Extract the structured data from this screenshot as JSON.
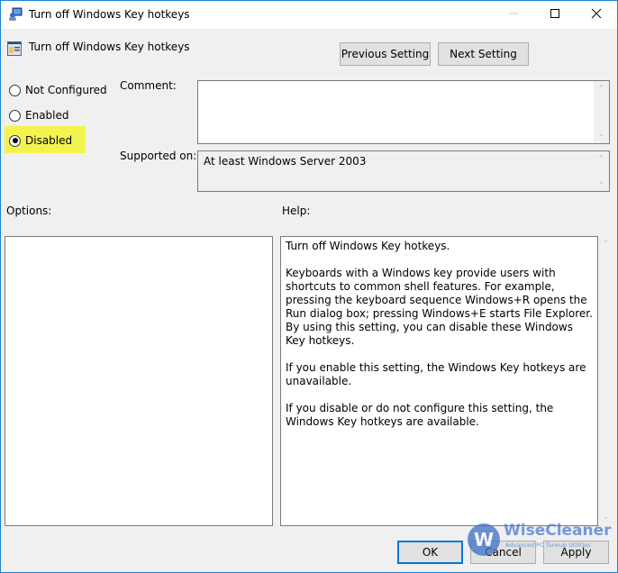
{
  "window": {
    "title": "Turn off Windows Key hotkeys",
    "controls": {
      "minimize": "minimize",
      "maximize": "maximize",
      "close": "close"
    }
  },
  "header": {
    "setting_name": "Turn off Windows Key hotkeys",
    "previous_label": "Previous Setting",
    "next_label": "Next Setting"
  },
  "state": {
    "options": [
      {
        "label": "Not Configured",
        "checked": false
      },
      {
        "label": "Enabled",
        "checked": false
      },
      {
        "label": "Disabled",
        "checked": true
      }
    ],
    "highlight_color": "#f3f350"
  },
  "comment": {
    "label": "Comment:",
    "value": ""
  },
  "supported": {
    "label": "Supported on:",
    "value": "At least Windows Server 2003"
  },
  "options_panel": {
    "label": "Options:"
  },
  "help_panel": {
    "label": "Help:",
    "text": "Turn off Windows Key hotkeys.\n\nKeyboards with a Windows key provide users with shortcuts to common shell features. For example, pressing the keyboard sequence Windows+R opens the Run dialog box; pressing Windows+E starts File Explorer. By using this setting, you can disable these Windows Key hotkeys.\n\nIf you enable this setting, the Windows Key hotkeys are unavailable.\n\nIf you disable or do not configure this setting, the Windows Key hotkeys are available."
  },
  "footer": {
    "ok_label": "OK",
    "cancel_label": "Cancel",
    "apply_label": "Apply"
  },
  "watermark": {
    "logo_letter": "W",
    "name": "WiseCleaner",
    "tagline": "Advanced PC Tuneup Utilities"
  },
  "colors": {
    "accent": "#0078d7",
    "window_border": "#1883d7"
  }
}
